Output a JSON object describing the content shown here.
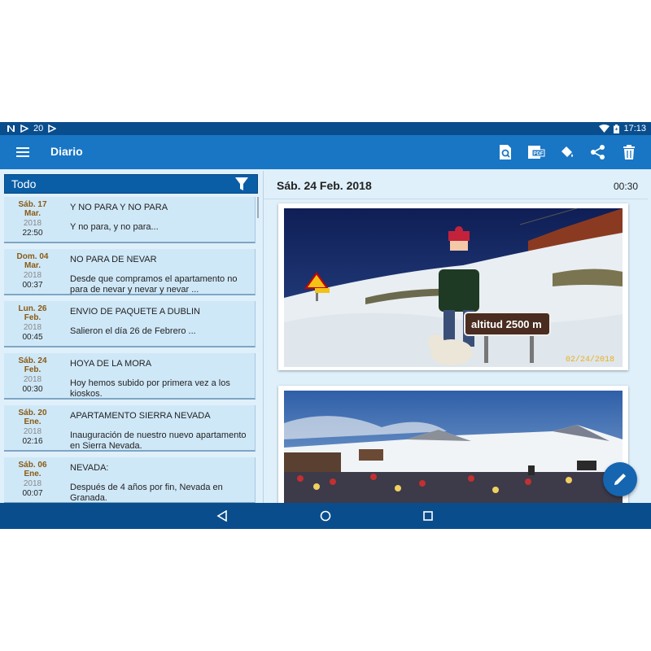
{
  "status_bar": {
    "notif_count": "20",
    "time": "17:13"
  },
  "app_bar": {
    "title": "Diario",
    "actions": [
      "search-document-icon",
      "pdf-icon",
      "paint-bucket-icon",
      "share-icon",
      "trash-icon"
    ]
  },
  "filter": {
    "label": "Todo"
  },
  "entries": [
    {
      "day": "Sáb. 17",
      "month": "Mar.",
      "year": "2018",
      "time": "22:50",
      "title": "Y NO PARA Y NO PARA",
      "excerpt": "Y no para, y no para..."
    },
    {
      "day": "Dom. 04",
      "month": "Mar.",
      "year": "2018",
      "time": "00:37",
      "title": "NO PARA DE NEVAR",
      "excerpt": "Desde que compramos el apartamento no para de nevar y nevar y nevar ..."
    },
    {
      "day": "Lun. 26",
      "month": "Feb.",
      "year": "2018",
      "time": "00:45",
      "title": "ENVIO DE PAQUETE A DUBLIN",
      "excerpt": "Salieron el día 26 de Febrero ..."
    },
    {
      "day": "Sáb. 24",
      "month": "Feb.",
      "year": "2018",
      "time": "00:30",
      "title": "HOYA DE LA MORA",
      "excerpt": "Hoy hemos subido por primera vez a los kioskos."
    },
    {
      "day": "Sáb. 20",
      "month": "Ene.",
      "year": "2018",
      "time": "02:16",
      "title": "APARTAMENTO SIERRA NEVADA",
      "excerpt": "Inauguración de nuestro nuevo apartamento en Sierra Nevada."
    },
    {
      "day": "Sáb. 06",
      "month": "Ene.",
      "year": "2018",
      "time": "00:07",
      "title": "NEVADA:",
      "excerpt": "Después de 4 años por fin, Nevada en Granada."
    }
  ],
  "detail": {
    "date": "Sáb. 24 Feb. 2018",
    "time": "00:30",
    "photo1_sign": "altitud  2500 m",
    "photo1_stamp": "02/24/2018"
  },
  "colors": {
    "primary": "#1976c4",
    "primary_dark": "#0a4d8c",
    "accent": "#1565b0",
    "date_brown": "#8a5a12",
    "background": "#dff0fb"
  }
}
